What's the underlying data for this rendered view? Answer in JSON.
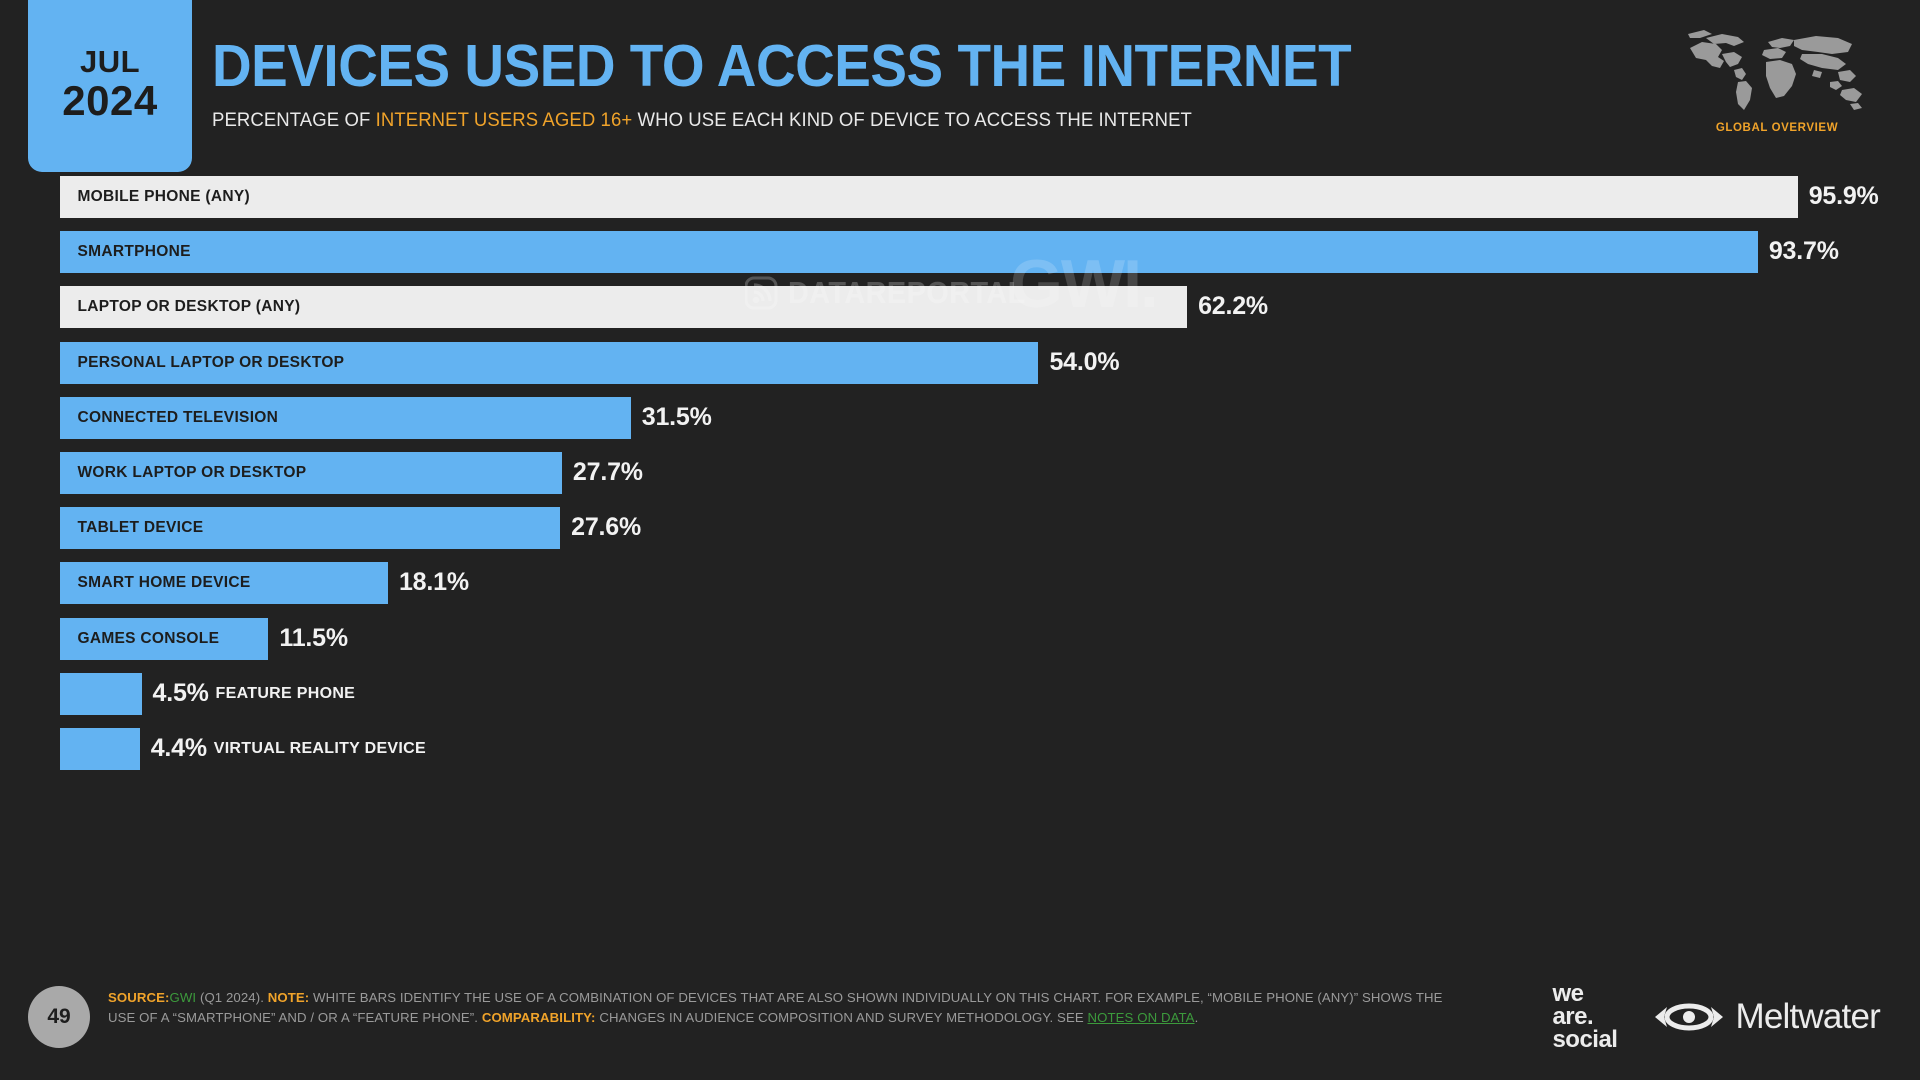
{
  "header": {
    "date_month": "JUL",
    "date_year": "2024",
    "title": "DEVICES USED TO ACCESS THE INTERNET",
    "subtitle_pre": "PERCENTAGE OF ",
    "subtitle_highlight": "INTERNET USERS AGED 16+",
    "subtitle_post": " WHO USE EACH KIND OF DEVICE TO ACCESS THE INTERNET",
    "region_label": "GLOBAL OVERVIEW"
  },
  "watermarks": {
    "datareportal": "DATAREPORTAL",
    "gwi": "GWI."
  },
  "colors": {
    "background": "#222222",
    "accent_blue": "#63b3f2",
    "white_bar": "#ececec",
    "accent_orange": "#f0a32a",
    "link_green": "#3c9a3c",
    "value_text": "#f2f2f2"
  },
  "footer": {
    "page_number": "49",
    "source_label": "SOURCE:",
    "source_name": "GWI",
    "source_detail": " (Q1 2024). ",
    "note_label": "NOTE:",
    "note_text": " WHITE BARS IDENTIFY THE USE OF A COMBINATION OF DEVICES THAT ARE ALSO SHOWN INDIVIDUALLY ON THIS CHART. FOR EXAMPLE, “MOBILE PHONE (ANY)” SHOWS THE USE OF A “SMARTPHONE” AND / OR A “FEATURE PHONE”. ",
    "comparability_label": "COMPARABILITY:",
    "comparability_text": " CHANGES IN AUDIENCE COMPOSITION AND SURVEY METHODOLOGY. SEE ",
    "notes_link": "NOTES ON DATA",
    "trailing": ".",
    "logo_we_are_social": "we\nare.\nsocial",
    "logo_meltwater": "Meltwater"
  },
  "chart_data": {
    "type": "bar",
    "orientation": "horizontal",
    "title": "DEVICES USED TO ACCESS THE INTERNET",
    "subtitle": "PERCENTAGE OF INTERNET USERS AGED 16+ WHO USE EACH KIND OF DEVICE TO ACCESS THE INTERNET",
    "xlabel": "",
    "ylabel": "",
    "xlim": [
      0,
      100
    ],
    "grid": false,
    "legend": null,
    "unit": "%",
    "categories": [
      "MOBILE PHONE (ANY)",
      "SMARTPHONE",
      "LAPTOP OR DESKTOP (ANY)",
      "PERSONAL LAPTOP OR DESKTOP",
      "CONNECTED TELEVISION",
      "WORK LAPTOP OR DESKTOP",
      "TABLET DEVICE",
      "SMART HOME DEVICE",
      "GAMES CONSOLE",
      "FEATURE PHONE",
      "VIRTUAL REALITY DEVICE"
    ],
    "values": [
      95.9,
      93.7,
      62.2,
      54.0,
      31.5,
      27.7,
      27.6,
      18.1,
      11.5,
      4.5,
      4.4
    ],
    "value_labels": [
      "95.9%",
      "93.7%",
      "62.2%",
      "54.0%",
      "31.5%",
      "27.7%",
      "27.6%",
      "18.1%",
      "11.5%",
      "4.5%",
      "4.4%"
    ],
    "bar_colors": [
      "white",
      "blue",
      "white",
      "blue",
      "blue",
      "blue",
      "blue",
      "blue",
      "blue",
      "blue",
      "blue"
    ],
    "label_placement": [
      "inside",
      "inside",
      "inside",
      "inside",
      "inside",
      "inside",
      "inside",
      "inside",
      "inside",
      "outside",
      "outside"
    ]
  }
}
